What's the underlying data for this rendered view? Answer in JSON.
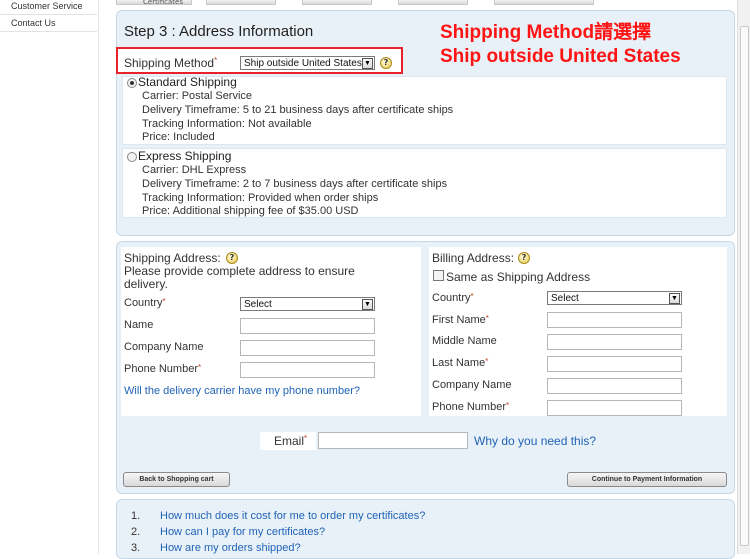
{
  "sidebar": {
    "items": [
      {
        "label": "Customer Service"
      },
      {
        "label": "Contact Us"
      }
    ]
  },
  "top_tabs": [
    {
      "label": "Certificates"
    }
  ],
  "step": {
    "title": "Step 3 : Address Information",
    "shipping_method_label": "Shipping Method",
    "shipping_method_value": "Ship outside United States",
    "help_glyph": "?"
  },
  "annotation": {
    "line1": "Shipping Method請選擇",
    "line2": "Ship outside United States",
    "color": "#ff1414"
  },
  "shipping_options": [
    {
      "title": "Standard Shipping",
      "selected": true,
      "lines": [
        "Carrier: Postal Service",
        "Delivery Timeframe: 5 to 21 business days after certificate ships",
        "Tracking Information: Not available",
        "Price: Included"
      ]
    },
    {
      "title": "Express Shipping",
      "selected": false,
      "lines": [
        "Carrier: DHL Express",
        "Delivery Timeframe: 2 to 7 business days after certificate ships",
        "Tracking Information: Provided when order ships",
        "Price: Additional shipping fee of $35.00 USD"
      ]
    }
  ],
  "shipping_address": {
    "title": "Shipping Address:",
    "description": "Please provide complete address to ensure delivery.",
    "country_label": "Country",
    "country_value": "Select",
    "name_label": "Name",
    "company_label": "Company Name",
    "phone_label": "Phone Number",
    "phone_link": "Will the delivery carrier have my phone number?"
  },
  "billing_address": {
    "title": "Billing Address:",
    "same_as_label": "Same as Shipping Address",
    "country_label": "Country",
    "country_value": "Select",
    "first_name_label": "First Name",
    "middle_name_label": "Middle Name",
    "last_name_label": "Last Name",
    "company_label": "Company Name",
    "phone_label": "Phone Number"
  },
  "email": {
    "label": "Email",
    "link": "Why do you need this?"
  },
  "buttons": {
    "back": "Back to Shopping cart",
    "continue": "Continue to Payment Information"
  },
  "faq": [
    {
      "num": "1.",
      "text": "How much does it cost for me to order my certificates?"
    },
    {
      "num": "2.",
      "text": "How can I pay for my certificates?"
    },
    {
      "num": "3.",
      "text": "How are my orders shipped?"
    }
  ],
  "colors": {
    "accent_link": "#1f63b5",
    "panel_bg": "#e9f1f8",
    "highlight_border": "#e8222a"
  }
}
